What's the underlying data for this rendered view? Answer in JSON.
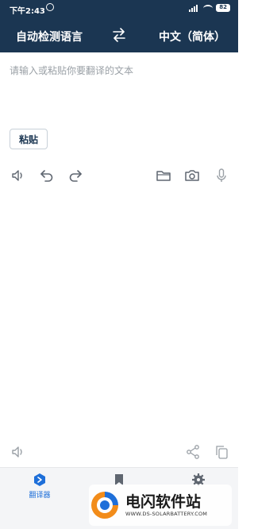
{
  "status_bar": {
    "time": "下午2:43",
    "battery": "82"
  },
  "header": {
    "source_language": "自动检测语言",
    "target_language": "中文（简体）"
  },
  "input": {
    "placeholder": "请输入或粘贴你要翻译的文本"
  },
  "paste_button": {
    "label": "粘贴"
  },
  "toolbar": {
    "icons": [
      "speaker-icon",
      "undo-icon",
      "redo-icon",
      "folder-icon",
      "camera-icon",
      "microphone-icon"
    ]
  },
  "output_toolbar": {
    "icons": [
      "speaker-icon",
      "share-icon",
      "copy-icon"
    ]
  },
  "bottom_nav": {
    "items": [
      {
        "label": "翻译器",
        "icon": "translator-icon",
        "active": true
      },
      {
        "label": "",
        "icon": "bookmark-icon",
        "active": false
      },
      {
        "label": "",
        "icon": "gear-icon",
        "active": false
      }
    ]
  },
  "watermark": {
    "title": "电闪软件站",
    "url": "WWW.DS-SOLARBATTERY.COM"
  },
  "colors": {
    "header_bg": "#1b3652",
    "accent": "#1e6fd9",
    "icon_gray": "#5f6670"
  }
}
